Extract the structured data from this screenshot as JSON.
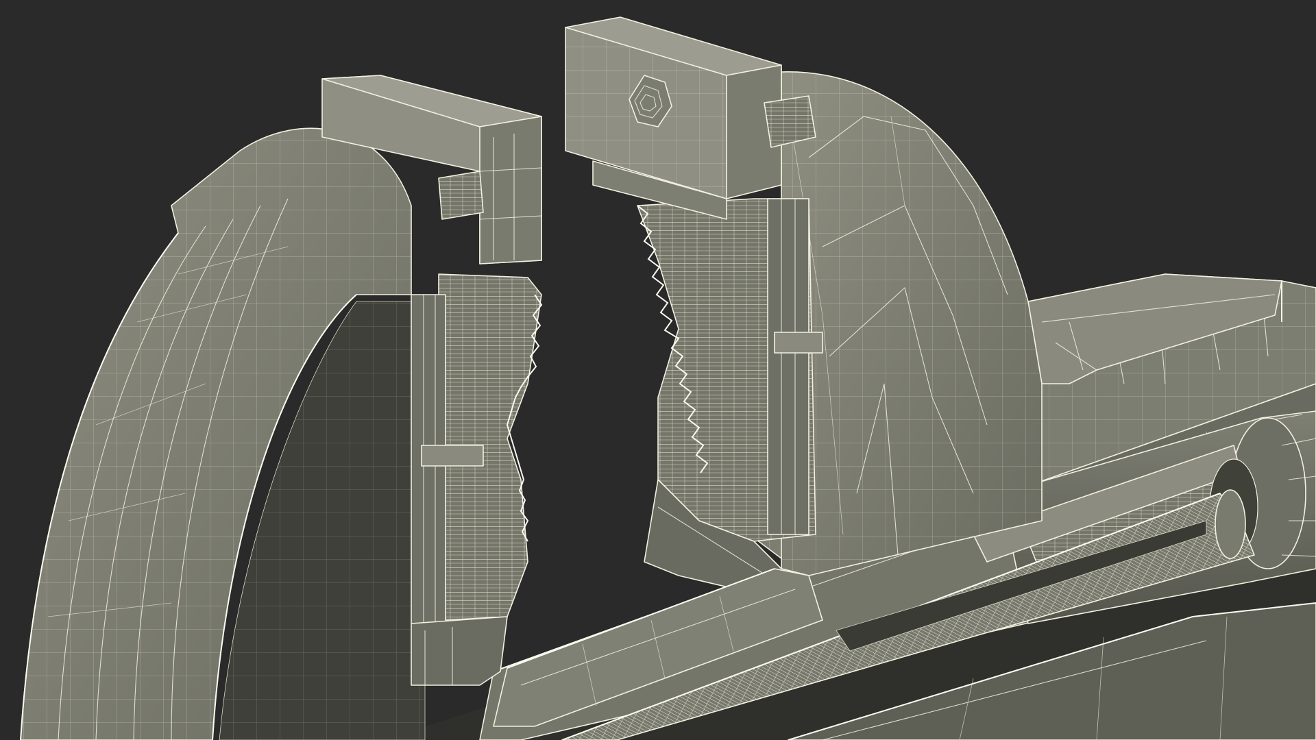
{
  "scene": {
    "subject": "bench-vise-wireframe-render",
    "palette": {
      "background": "#2a2a2a",
      "mesh_light": "#8a8b7d",
      "mesh_mid": "#707165",
      "mesh_dark": "#4c4d45",
      "mesh_shadow": "#303129",
      "wire": "#f3f1e2"
    }
  }
}
